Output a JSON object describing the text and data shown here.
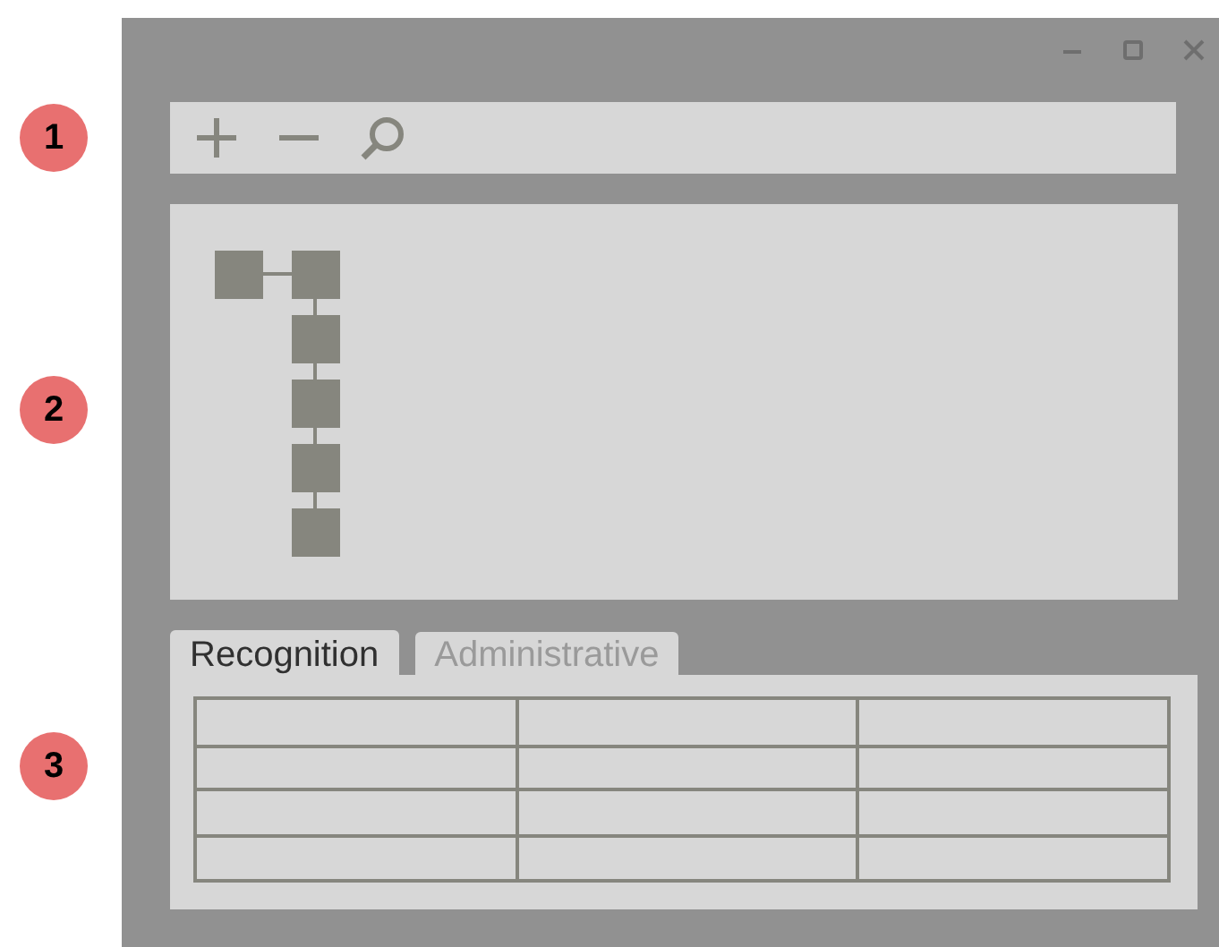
{
  "callouts": [
    "1",
    "2",
    "3"
  ],
  "tabs": [
    {
      "label": "Recognition",
      "selected": true
    },
    {
      "label": "Administrative",
      "selected": false
    }
  ]
}
